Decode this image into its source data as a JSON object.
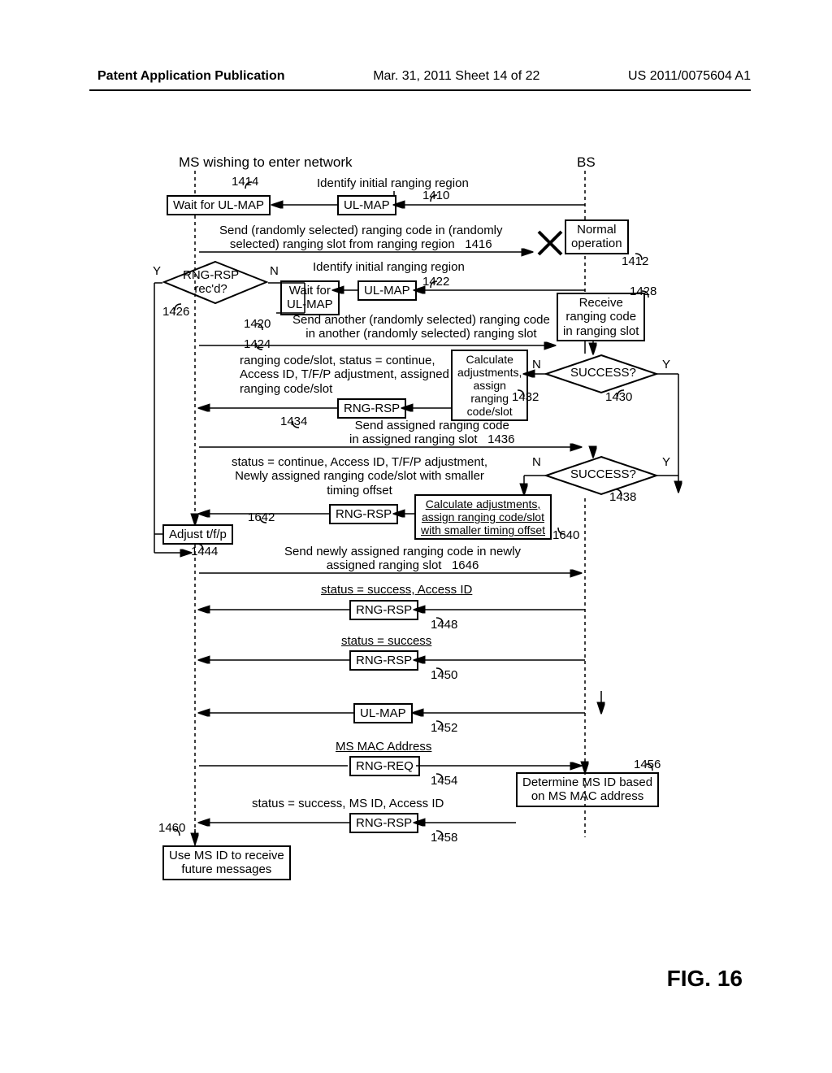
{
  "header": {
    "left": "Patent Application Publication",
    "center": "Mar. 31, 2011  Sheet 14 of 22",
    "right": "US 2011/0075604 A1"
  },
  "figure_label": "FIG. 16",
  "titles": {
    "ms": "MS wishing to enter network",
    "bs": "BS"
  },
  "boxes": {
    "wait_ulmap1": "Wait for UL-MAP",
    "ulmap1": "UL-MAP",
    "normal_op": "Normal\noperation",
    "rng_rsp_rec": "RNG-RSP\nrec'd?",
    "wait_ulmap2": "Wait for\nUL-MAP",
    "ulmap2": "UL-MAP",
    "receive_code": "Receive\nranging code\nin ranging slot",
    "success1": "SUCCESS?",
    "rng_rsp_1434": "RNG-RSP",
    "calc1": "Calculate\nadjustments,\nassign\nranging\ncode/slot",
    "success2": "SUCCESS?",
    "calc2": "Calculate adjustments,\nassign ranging code/slot\nwith smaller timing offset",
    "rng_rsp_1642": "RNG-RSP",
    "adjust": "Adjust t/f/p",
    "rng_rsp_1448": "RNG-RSP",
    "rng_rsp_1450": "RNG-RSP",
    "ulmap3": "UL-MAP",
    "rng_req": "RNG-REQ",
    "determine": "Determine MS ID based\non MS MAC address",
    "rng_rsp_1458": "RNG-RSP",
    "use_msid": "Use MS ID to receive\nfuture messages"
  },
  "annotations": {
    "a1410": "Identify initial ranging region",
    "a1416": "Send (randomly selected) ranging code in (randomly\nselected) ranging slot from ranging region   1416",
    "a1422": "Identify initial ranging region",
    "a1424": "Send another (randomly selected) ranging code\nin another (randomly selected) ranging slot",
    "a1434": "ranging code/slot, status = continue,\nAccess ID, T/F/P adjustment, assigned\nranging code/slot",
    "a1436": "Send assigned ranging code\nin assigned ranging slot   1436",
    "a1642": "status = continue, Access ID, T/F/P adjustment,\nNewly assigned ranging code/slot with smaller\ntiming offset",
    "a1646": "Send newly assigned ranging code in newly\nassigned ranging slot   1646",
    "a1448": "status = success, Access ID",
    "a1450": "status = success",
    "a1454": "MS MAC Address",
    "a1458": "status = success, MS ID, Access ID"
  },
  "refs": {
    "r1410": "1410",
    "r1412": "1412",
    "r1414": "1414",
    "r1420": "1420",
    "r1422": "1422",
    "r1424": "1424",
    "r1426": "1426",
    "r1428": "1428",
    "r1430": "1430",
    "r1432": "1432",
    "r1434": "1434",
    "r1438": "1438",
    "r1444": "1444",
    "r1448": "1448",
    "r1450": "1450",
    "r1452": "1452",
    "r1454": "1454",
    "r1456": "1456",
    "r1458": "1458",
    "r1460": "1460",
    "r1640": "1640",
    "r1642": "1642",
    "Y": "Y",
    "N": "N"
  },
  "chart_data": {
    "type": "table",
    "description": "Message sequence chart between MS (mobile station) entering network and BS (base station) for ranging procedure.",
    "lifelines": [
      "MS",
      "BS"
    ],
    "steps": [
      {
        "ref": "1410",
        "dir": "BS→MS",
        "msg": "UL-MAP",
        "note": "Identify initial ranging region"
      },
      {
        "ref": "1414",
        "at": "MS",
        "action": "Wait for UL-MAP"
      },
      {
        "ref": "1412",
        "at": "BS",
        "action": "Normal operation"
      },
      {
        "ref": "1416",
        "dir": "MS→BS",
        "msg": "Send (randomly selected) ranging code in (randomly selected) ranging slot from ranging region",
        "result": "fail (X)"
      },
      {
        "ref": "1422",
        "dir": "BS→MS",
        "msg": "UL-MAP",
        "note": "Identify initial ranging region"
      },
      {
        "ref": "1426",
        "at": "MS",
        "decision": "RNG-RSP rec'd?",
        "Y": "continue",
        "N": "Wait for UL-MAP (1420)"
      },
      {
        "ref": "1424",
        "dir": "MS→BS",
        "msg": "Send another (randomly selected) ranging code in another (randomly selected) ranging slot"
      },
      {
        "ref": "1428",
        "at": "BS",
        "action": "Receive ranging code in ranging slot"
      },
      {
        "ref": "1430",
        "at": "BS",
        "decision": "SUCCESS?",
        "N": "→1432",
        "Y": "skip"
      },
      {
        "ref": "1432",
        "at": "BS",
        "action": "Calculate adjustments, assign ranging code/slot"
      },
      {
        "ref": "1434",
        "dir": "BS→MS",
        "msg": "RNG-RSP",
        "note": "ranging code/slot, status=continue, Access ID, T/F/P adjustment, assigned ranging code/slot"
      },
      {
        "ref": "1436",
        "dir": "MS→BS",
        "msg": "Send assigned ranging code in assigned ranging slot"
      },
      {
        "ref": "1438",
        "at": "BS",
        "decision": "SUCCESS?",
        "N": "→1640",
        "Y": "skip"
      },
      {
        "ref": "1640",
        "at": "BS",
        "action": "Calculate adjustments, assign ranging code/slot with smaller timing offset"
      },
      {
        "ref": "1642",
        "dir": "BS→MS",
        "msg": "RNG-RSP",
        "note": "status=continue, Access ID, T/F/P adjustment, newly assigned ranging code/slot with smaller timing offset"
      },
      {
        "ref": "1444",
        "at": "MS",
        "action": "Adjust t/f/p"
      },
      {
        "ref": "1646",
        "dir": "MS→BS",
        "msg": "Send newly assigned ranging code in newly assigned ranging slot"
      },
      {
        "ref": "1448",
        "dir": "BS→MS",
        "msg": "RNG-RSP",
        "note": "status=success, Access ID"
      },
      {
        "ref": "1450",
        "dir": "BS→MS",
        "msg": "RNG-RSP",
        "note": "status=success"
      },
      {
        "ref": "1452",
        "dir": "BS→MS",
        "msg": "UL-MAP"
      },
      {
        "ref": "1454",
        "dir": "MS→BS",
        "msg": "RNG-REQ",
        "note": "MS MAC Address"
      },
      {
        "ref": "1456",
        "at": "BS",
        "action": "Determine MS ID based on MS MAC address"
      },
      {
        "ref": "1458",
        "dir": "BS→MS",
        "msg": "RNG-RSP",
        "note": "status=success, MS ID, Access ID"
      },
      {
        "ref": "1460",
        "at": "MS",
        "action": "Use MS ID to receive future messages"
      }
    ]
  }
}
